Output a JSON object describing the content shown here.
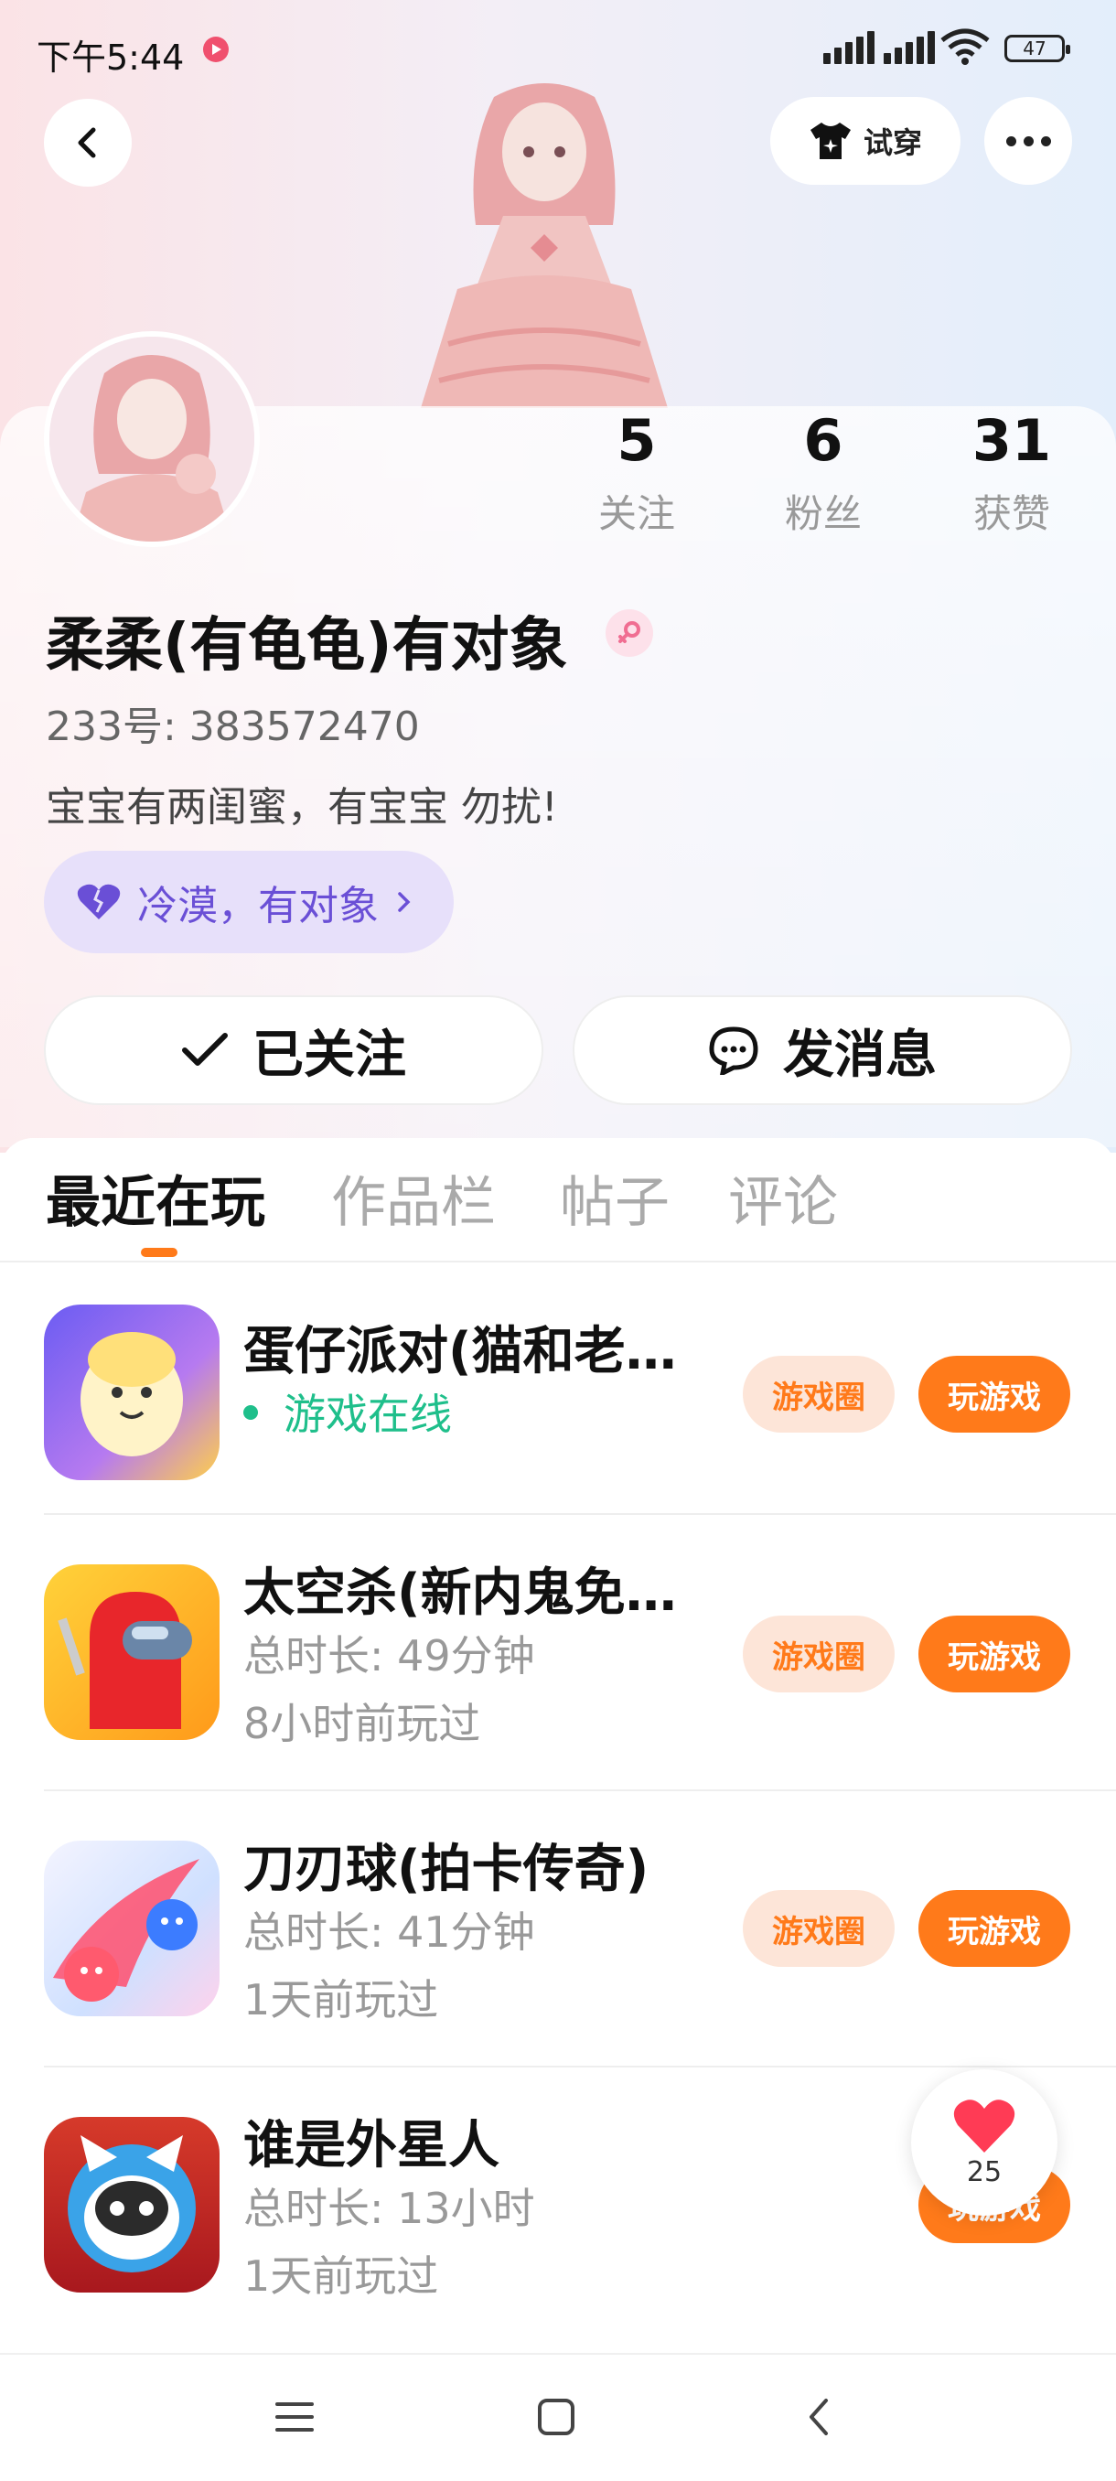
{
  "status_bar": {
    "time": "下午5:44",
    "battery": "47"
  },
  "header": {
    "try_on_label": "试穿"
  },
  "profile": {
    "stats": [
      {
        "value": "5",
        "label": "关注"
      },
      {
        "value": "6",
        "label": "粉丝"
      },
      {
        "value": "31",
        "label": "获赞"
      }
    ],
    "nickname": "柔柔(有龟龟)有对象",
    "id_text": "233号: 383572470",
    "bio": "宝宝有两闺蜜，有宝宝   勿扰!",
    "tag": "冷漠，有对象"
  },
  "actions": {
    "followed_label": "已关注",
    "message_label": "发消息"
  },
  "tabs": [
    "最近在玩",
    "作品栏",
    "帖子",
    "评论"
  ],
  "games": [
    {
      "title": "蛋仔派对(猫和老…",
      "line1": "游戏在线",
      "line2": "",
      "online": true
    },
    {
      "title": "太空杀(新内鬼免…",
      "line1": "总时长: 49分钟",
      "line2": "8小时前玩过",
      "online": false
    },
    {
      "title": "刀刃球(拍卡传奇)",
      "line1": "总时长: 41分钟",
      "line2": "1天前玩过",
      "online": false
    },
    {
      "title": "谁是外星人",
      "line1": "总时长: 13小时",
      "line2": "1天前玩过",
      "online": false
    }
  ],
  "game_buttons": {
    "circle_label": "游戏圈",
    "play_label": "玩游戏"
  },
  "like_float": {
    "count": "25"
  },
  "colors": {
    "accent": "#ff7a1a",
    "online": "#1fbf8b",
    "tag_text": "#6a4fd6"
  }
}
